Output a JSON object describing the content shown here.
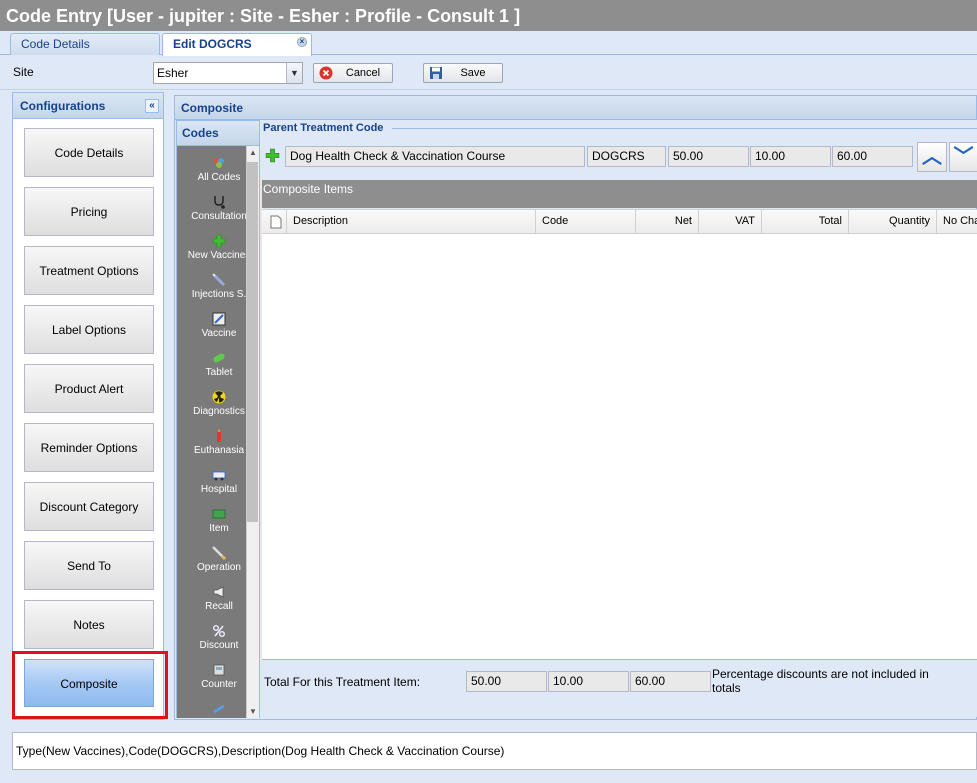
{
  "window": {
    "title": "Code Entry [User - jupiter : Site - Esher : Profile - Consult 1 ]"
  },
  "tabs": [
    {
      "label": "Code Details"
    },
    {
      "label": "Edit DOGCRS",
      "close": "×"
    }
  ],
  "toolbar": {
    "site_label": "Site",
    "site_value": "Esher",
    "cancel_label": "Cancel",
    "save_label": "Save"
  },
  "configurations": {
    "title": "Configurations",
    "collapse_icon": "«",
    "items": [
      {
        "label": "Code Details"
      },
      {
        "label": "Pricing"
      },
      {
        "label": "Treatment Options"
      },
      {
        "label": "Label Options"
      },
      {
        "label": "Product Alert"
      },
      {
        "label": "Reminder Options"
      },
      {
        "label": "Discount Category"
      },
      {
        "label": "Send To"
      },
      {
        "label": "Notes"
      },
      {
        "label": "Composite",
        "selected": true
      }
    ]
  },
  "composite": {
    "title": "Composite",
    "codes_title": "Codes",
    "codes": [
      {
        "label": "All Codes",
        "icon": "all-codes-icon"
      },
      {
        "label": "Consultation",
        "icon": "stethoscope-icon"
      },
      {
        "label": "New Vaccines",
        "icon": "green-plus-icon"
      },
      {
        "label": "Injections S.",
        "icon": "syringe-icon"
      },
      {
        "label": "Vaccine",
        "icon": "vaccine-icon"
      },
      {
        "label": "Tablet",
        "icon": "tablet-icon"
      },
      {
        "label": "Diagnostics",
        "icon": "radiation-icon"
      },
      {
        "label": "Euthanasia",
        "icon": "euthanasia-icon"
      },
      {
        "label": "Hospital",
        "icon": "ambulance-icon"
      },
      {
        "label": "Item",
        "icon": "item-icon"
      },
      {
        "label": "Operation",
        "icon": "scalpel-icon"
      },
      {
        "label": "Recall",
        "icon": "megaphone-icon"
      },
      {
        "label": "Discount",
        "icon": "percent-icon"
      },
      {
        "label": "Counter",
        "icon": "counter-icon"
      }
    ],
    "parent": {
      "title": "Parent Treatment Code",
      "description": "Dog Health Check & Vaccination Course",
      "code": "DOGCRS",
      "net": "50.00",
      "vat": "10.00",
      "total": "60.00"
    },
    "items_title": "Composite Items",
    "columns": [
      "Description",
      "Code",
      "Net",
      "VAT",
      "Total",
      "Quantity",
      "No Cha"
    ],
    "footer": {
      "label": "Total For this Treatment Item:",
      "net": "50.00",
      "vat": "10.00",
      "total": "60.00",
      "note": "Percentage discounts are not included in totals"
    }
  },
  "status": {
    "text": "Type(New Vaccines),Code(DOGCRS),Description(Dog Health Check & Vaccination Course)"
  }
}
